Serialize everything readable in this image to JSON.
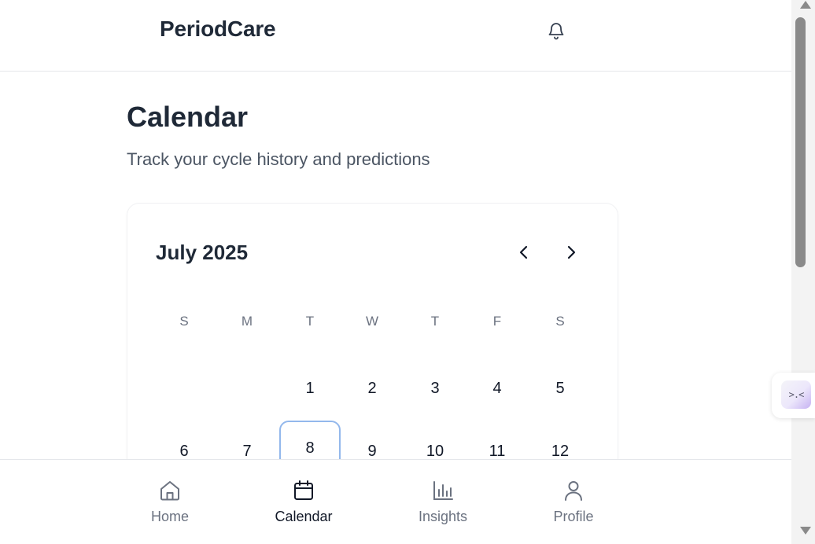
{
  "app": {
    "brand": "PeriodCare",
    "notification_icon": "bell-icon"
  },
  "page": {
    "title": "Calendar",
    "subtitle": "Track your cycle history and predictions"
  },
  "calendar": {
    "month_label": "July 2025",
    "prev_icon": "chevron-left-icon",
    "next_icon": "chevron-right-icon",
    "weekdays": [
      "S",
      "M",
      "T",
      "W",
      "T",
      "F",
      "S"
    ],
    "week1": [
      "",
      "",
      "1",
      "2",
      "3",
      "4",
      "5"
    ],
    "week2": [
      "6",
      "7",
      "8",
      "9",
      "10",
      "11",
      "12"
    ],
    "today": "8",
    "today_color": "#93b8ec"
  },
  "bottom_nav": {
    "items": [
      {
        "label": "Home",
        "icon": "home-icon"
      },
      {
        "label": "Calendar",
        "icon": "calendar-icon",
        "active": true
      },
      {
        "label": "Insights",
        "icon": "bar-chart-icon"
      },
      {
        "label": "Profile",
        "icon": "user-icon"
      }
    ]
  },
  "floating_widget": {
    "face": ">.<"
  },
  "colors": {
    "text_primary": "#1f2937",
    "text_secondary": "#4b5563",
    "muted": "#6b7280",
    "divider": "#e5e7eb"
  }
}
